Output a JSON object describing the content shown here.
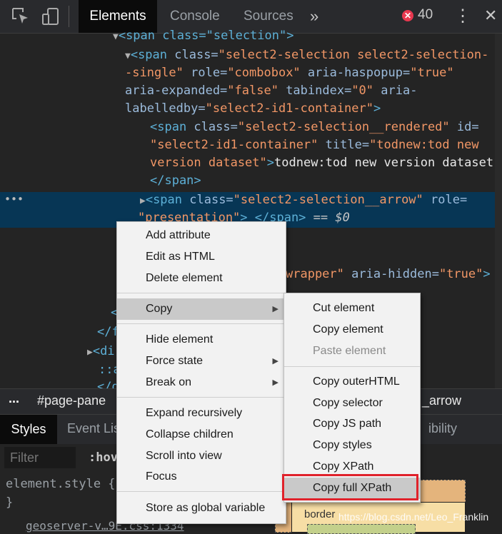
{
  "toolbar": {
    "inspect_icon": "inspect-element-icon",
    "device_icon": "device-toggle-icon",
    "tabs": [
      "Elements",
      "Console",
      "Sources"
    ],
    "more_tabs": "»",
    "error_badge": "✕",
    "error_count": "40",
    "kebab": "⋮",
    "close": "✕"
  },
  "dom": {
    "l1": "<span class=\"selection\">",
    "l2a_tag": "<span ",
    "l2a_attr1": "class=",
    "l2a_val1": "\"select2-selection select2-selection-",
    "l2b_val1": "-single\"",
    "l2b_attr2": " role=",
    "l2b_val2": "\"combobox\"",
    "l2b_attr3": " aria-haspopup=",
    "l2b_val3": "\"true\"",
    "l2c_attr4": "aria-expanded=",
    "l2c_val4": "\"false\"",
    "l2c_attr5": " tabindex=",
    "l2c_val5": "\"0\"",
    "l2c_attr6": " aria-",
    "l2d_attr6b": "labelledby=",
    "l2d_val6": "\"select2-id1-container\"",
    "l2d_close": ">",
    "l3a_tag": "<span ",
    "l3a_attr1": "class=",
    "l3a_val1": "\"select2-selection__rendered\"",
    "l3a_attr2": " id=",
    "l3b_val2": "\"select2-id1-container\"",
    "l3b_attr3": " title=",
    "l3b_val3": "\"todnew:tod new",
    "l3c_val3b": "version dataset\"",
    "l3c_close": ">",
    "l3c_text": "todnew:tod new version dataset",
    "l3d_close": "</span>",
    "l4a_tag": "<span ",
    "l4a_attr1": "class=",
    "l4a_val1": "\"select2-selection__arrow\"",
    "l4a_attr2": " role=",
    "l4b_val2": "\"presentation\"",
    "l4b_close": "> </span>",
    "l4b_eq": " == $0",
    "l5_frag_val": "wrapper\"",
    "l5_frag_attr": " aria-hidden=",
    "l5_frag_val2": "\"true\"",
    "l5_frag_close": ">",
    "frag_a": "<",
    "frag_b": "</f",
    "frag_c": "<di",
    "frag_d": "::a",
    "frag_e": "</di"
  },
  "crumbs": {
    "dots": "...",
    "page_pane": "#page-pane",
    "arrow_tail": "_arrow"
  },
  "styles": {
    "tab_styles": "Styles",
    "tab_event": "Event Lis",
    "tab_access": "ibility",
    "filter_placeholder": "Filter",
    "hov": ":hov",
    "element_style": "element.style {",
    "close_brace": "}",
    "sheet_link": "geoserver-v…9E.css:1334",
    "box_border_label": "border",
    "watermark": "https://blog.csdn.net/Leo_Franklin"
  },
  "context_menu": {
    "items": [
      "Add attribute",
      "Edit as HTML",
      "Delete element",
      "Copy",
      "Hide element",
      "Force state",
      "Break on",
      "Expand recursively",
      "Collapse children",
      "Scroll into view",
      "Focus",
      "Store as global variable"
    ],
    "submenu_arrow": "▶"
  },
  "copy_submenu": {
    "items": [
      "Cut element",
      "Copy element",
      "Paste element",
      "Copy outerHTML",
      "Copy selector",
      "Copy JS path",
      "Copy styles",
      "Copy XPath",
      "Copy full XPath"
    ]
  },
  "colors": {
    "selection_row": "#073655",
    "highlight_box": "#e0222b",
    "tag": "#5db0d7",
    "attr_value": "#f29766"
  }
}
